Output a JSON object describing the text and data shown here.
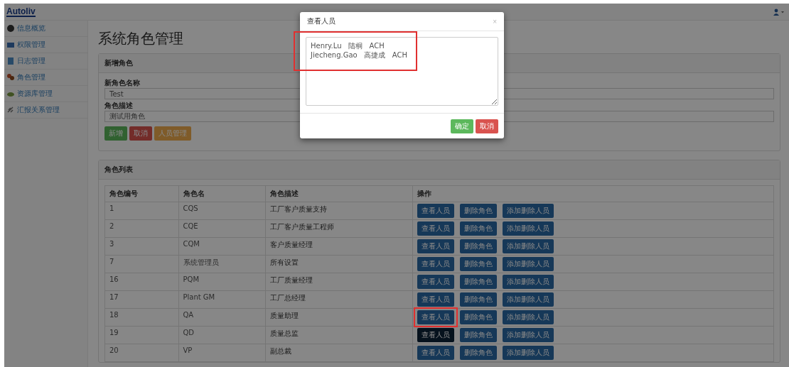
{
  "brand": {
    "logo": "Autoliv"
  },
  "sidebar": {
    "items": [
      {
        "label": "信息概览"
      },
      {
        "label": "权限管理"
      },
      {
        "label": "日志管理"
      },
      {
        "label": "角色管理"
      },
      {
        "label": "资源库管理"
      },
      {
        "label": "汇报关系管理"
      }
    ]
  },
  "page_title": "系统角色管理",
  "new_role": {
    "title": "新增角色",
    "name_label": "新角色名称",
    "name_value": "Test",
    "desc_label": "角色描述",
    "desc_value": "测试用角色",
    "buttons": [
      {
        "label": "新增",
        "kind": "success"
      },
      {
        "label": "取消",
        "kind": "danger"
      },
      {
        "label": "人员管理",
        "kind": "warning"
      }
    ]
  },
  "role_list": {
    "title": "角色列表",
    "columns": [
      "角色编号",
      "角色名",
      "角色描述",
      "操作"
    ],
    "rows": [
      {
        "id": "1",
        "name": "CQS",
        "description": "工厂客户质量支持",
        "actions": [
          "查看人员",
          "删除角色",
          "添加删除人员"
        ],
        "pressed": false,
        "marked": false
      },
      {
        "id": "2",
        "name": "CQE",
        "description": "工厂客户质量工程师",
        "actions": [
          "查看人员",
          "删除角色",
          "添加删除人员"
        ],
        "pressed": false,
        "marked": false
      },
      {
        "id": "3",
        "name": "CQM",
        "description": "客户质量经理",
        "actions": [
          "查看人员",
          "删除角色",
          "添加删除人员"
        ],
        "pressed": false,
        "marked": false
      },
      {
        "id": "7",
        "name": "系统管理员",
        "description": "所有设置",
        "actions": [
          "查看人员",
          "删除角色",
          "添加删除人员"
        ],
        "pressed": false,
        "marked": false
      },
      {
        "id": "16",
        "name": "PQM",
        "description": "工厂质量经理",
        "actions": [
          "查看人员",
          "删除角色",
          "添加删除人员"
        ],
        "pressed": false,
        "marked": false
      },
      {
        "id": "17",
        "name": "Plant GM",
        "description": "工厂总经理",
        "actions": [
          "查看人员",
          "删除角色",
          "添加删除人员"
        ],
        "pressed": false,
        "marked": false
      },
      {
        "id": "18",
        "name": "QA",
        "description": "质量助理",
        "actions": [
          "查看人员",
          "删除角色",
          "添加删除人员"
        ],
        "pressed": false,
        "marked": true
      },
      {
        "id": "19",
        "name": "QD",
        "description": "质量总监",
        "actions": [
          "查看人员",
          "删除角色",
          "添加删除人员"
        ],
        "pressed": true,
        "marked": false
      },
      {
        "id": "20",
        "name": "VP",
        "description": "副总裁",
        "actions": [
          "查看人员",
          "删除角色",
          "添加删除人员"
        ],
        "pressed": false,
        "marked": false
      }
    ]
  },
  "modal": {
    "title": "查看人员",
    "close": "×",
    "people": "Henry.Lu   陆桐   ACH\nJiecheng.Gao   高捷成   ACH",
    "people_marked": true,
    "buttons": [
      {
        "label": "确定",
        "kind": "success"
      },
      {
        "label": "取消",
        "kind": "danger"
      }
    ]
  }
}
